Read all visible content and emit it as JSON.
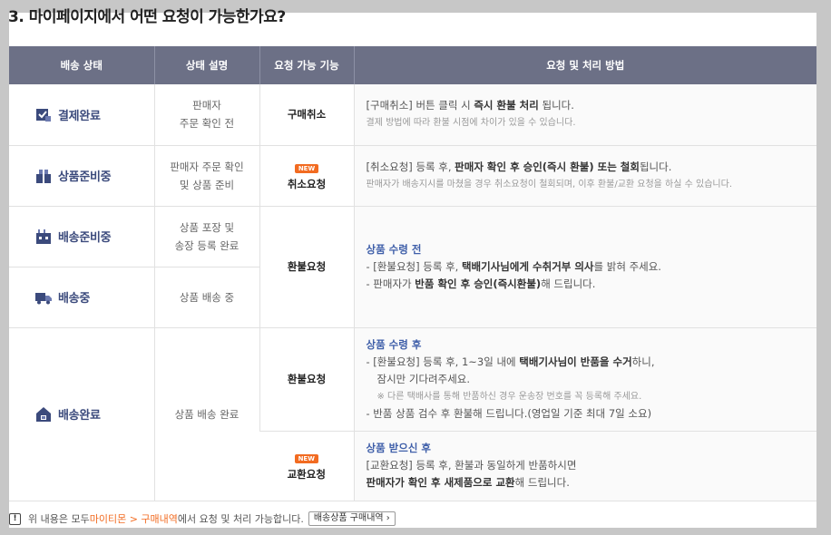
{
  "heading": "3. 마이페이지에서 어떤 요청이 가능한가요?",
  "table": {
    "headers": [
      "배송 상태",
      "상태 설명",
      "요청 가능 기능",
      "요청 및 처리 방법"
    ],
    "rows": {
      "paid": {
        "status": "결제완료",
        "status_icon": "payment-check-icon",
        "desc_1": "판매자",
        "desc_2": "주문 확인 전",
        "function": "구매취소",
        "method_1_prefix": "[구매취소] 버튼 클릭 시 ",
        "method_1_bold": "즉시 환불 처리",
        "method_1_suffix": " 됩니다.",
        "method_note": "결제 방법에 따라 환불 시점에 차이가 있을 수 있습니다."
      },
      "preparing": {
        "status": "상품준비중",
        "status_icon": "gift-box-icon",
        "desc_1": "판매자 주문 확인",
        "desc_2": "및 상품 준비",
        "badge": "NEW",
        "function": "취소요청",
        "method_1_prefix": "[취소요청] 등록 후, ",
        "method_1_bold": "판매자 확인 후 승인(즉시 환불) 또는 철회",
        "method_1_suffix": "됩니다.",
        "method_note": "판매자가 배송지시를 마쳤을 경우 취소요청이 철회되며, 이후 환불/교환 요청을 하실 수 있습니다."
      },
      "ship_ready": {
        "status": "배송준비중",
        "status_icon": "warehouse-icon",
        "desc_1": "상품 포장 및",
        "desc_2": "송장 등록 완료"
      },
      "shipping": {
        "status": "배송중",
        "status_icon": "delivery-truck-icon",
        "desc": "상품 배송 중"
      },
      "refund_before": {
        "function": "환불요청",
        "head": "상품 수령 전",
        "line1_prefix": "- [환불요청] 등록 후, ",
        "line1_bold": "택배기사님에게 수취거부 의사",
        "line1_suffix": "를 밝혀 주세요.",
        "line2_prefix": "- 판매자가 ",
        "line2_bold": "반품 확인 후 승인(즉시환불)",
        "line2_suffix": "해 드립니다."
      },
      "delivered": {
        "status": "배송완료",
        "status_icon": "home-delivered-icon",
        "desc": "상품 배송 완료",
        "refund_function": "환불요청",
        "refund_head": "상품 수령 후",
        "refund_line1_prefix": "- [환불요청] 등록 후, 1~3일 내에 ",
        "refund_line1_bold": "택배기사님이 반품을 수거",
        "refund_line1_suffix": "하니,",
        "refund_line2": "잠시만 기다려주세요.",
        "refund_note": "※ 다른 택배사를 통해 반품하신 경우 운송장 번호를 꼭 등록해 주세요.",
        "refund_line3": "- 반품 상품 검수 후 환불해 드립니다.(영업일 기준 최대 7일 소요)",
        "exchange_badge": "NEW",
        "exchange_function": "교환요청",
        "exchange_head": "상품 받으신 후",
        "exchange_line1": "[교환요청] 등록 후, 환불과 동일하게 반품하시면",
        "exchange_line2_bold": "판매자가 확인 후 새제품으로 교환",
        "exchange_line2_suffix": "해 드립니다."
      }
    }
  },
  "footer": {
    "icon": "exclamation-icon",
    "text_prefix": "위 내용은 모두 ",
    "link": "마이티몬 > 구매내역",
    "text_suffix": "에서 요청 및 처리 가능합니다.",
    "button": "배송상품 구매내역 ›"
  },
  "colors": {
    "header_bg": "#6c7086",
    "status_text": "#3b4a7c",
    "accent_orange": "#f26b21",
    "method_head": "#3f5fa9"
  }
}
